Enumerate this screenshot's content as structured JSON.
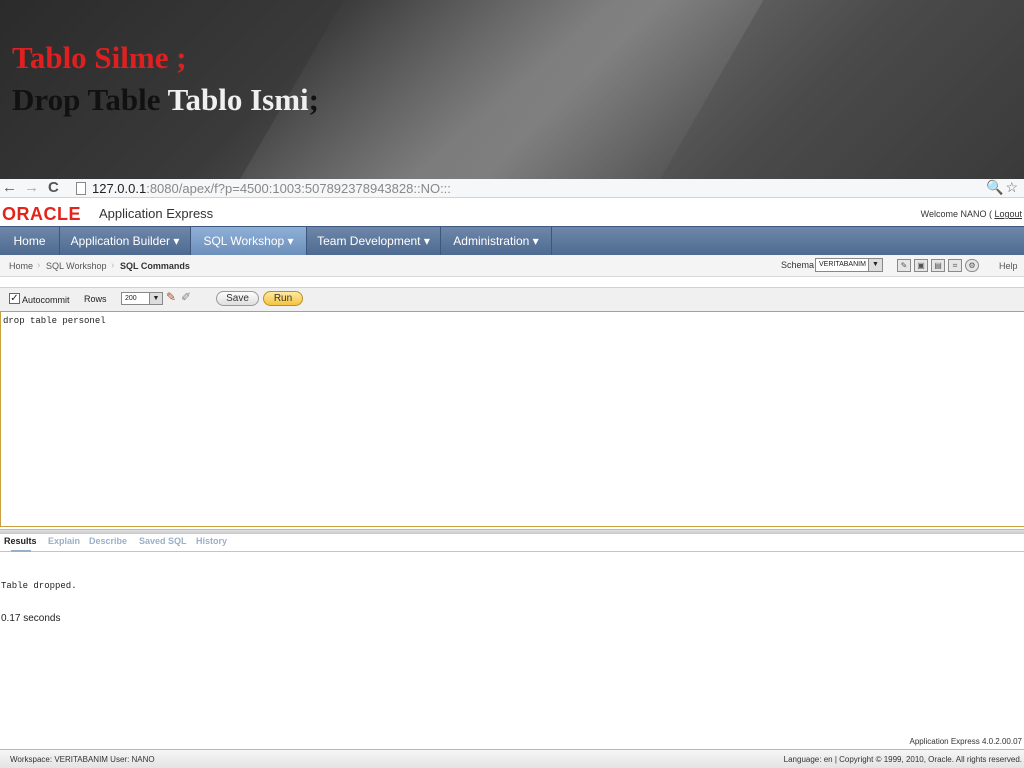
{
  "slide": {
    "line1": "Tablo Silme ;",
    "line2_dark": "Drop Table ",
    "line2_light": "Tablo Ismi",
    "line2_end": ";"
  },
  "browser": {
    "back": "←",
    "forward": "→",
    "reload": "C",
    "url_host": "127.0.0.1",
    "url_rest": ":8080/apex/f?p=4500:1003:507892378943828::NO:::",
    "right_icons": "🔍☆"
  },
  "apex": {
    "logo": "ORACLE",
    "product": "Application Express",
    "welcome": "Welcome NANO  ( ",
    "logout": "Logout"
  },
  "nav": {
    "tabs": [
      "Home",
      "Application Builder ▾",
      "SQL Workshop ▾",
      "Team Development ▾",
      "Administration ▾"
    ]
  },
  "breadcrumb": {
    "items": [
      "Home",
      "SQL Workshop",
      "SQL Commands"
    ],
    "schema_label": "Schema",
    "schema_value": "VERITABANIM",
    "help": "Help"
  },
  "toolbar": {
    "autocommit": "Autocommit",
    "rows_label": "Rows",
    "rows_value": "200",
    "save": "Save",
    "run": "Run"
  },
  "editor": {
    "sql": "drop table personel"
  },
  "results": {
    "tabs": [
      "Results",
      "Explain",
      "Describe",
      "Saved SQL",
      "History"
    ],
    "message": "Table dropped.",
    "time": "0.17 seconds"
  },
  "footer": {
    "version": "Application Express 4.0.2.00.07",
    "workspace": "Workspace: VERITABANIM User: NANO",
    "copyright": "Language: en | Copyright © 1999, 2010, Oracle. All rights reserved."
  },
  "colors": {
    "oracle_red": "#e3241b",
    "title_red": "#e02020",
    "nav_blue": "#4e6a91",
    "run_gold": "#f3c440"
  }
}
